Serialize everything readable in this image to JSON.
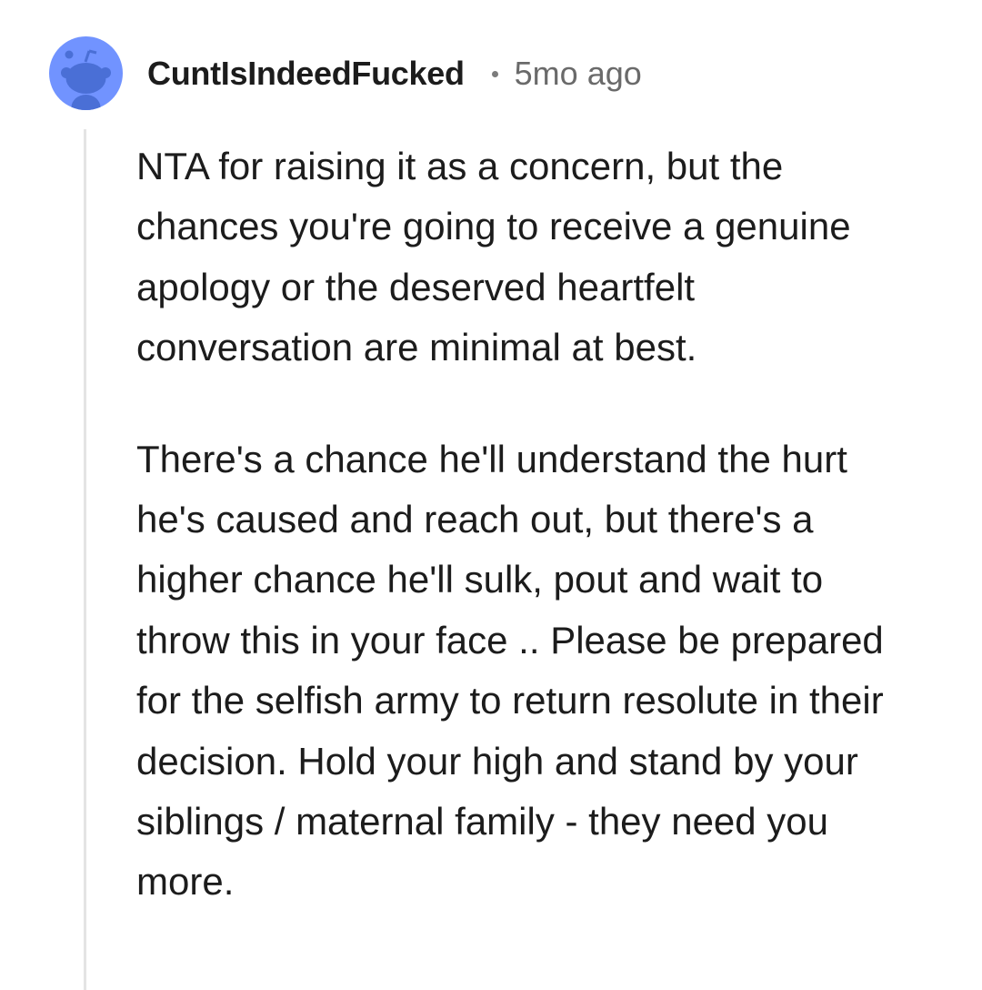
{
  "comment": {
    "author": "CuntIsIndeedFucked",
    "separator": "•",
    "timestamp": "5mo ago",
    "avatar_icon": "reddit-snoo-icon",
    "avatar_color": "#7193ff",
    "paragraphs": [
      "NTA for raising it as a concern, but the chances you're going to receive a genuine apology or the deserved heartfelt conversation are minimal at best.",
      "There's a chance he'll understand the hurt he's caused and reach out, but there's a higher chance he'll sulk, pout and wait to throw this in your face .. Please be prepared for the selfish army to return resolute in their decision. Hold your high and stand by your siblings / maternal family - they need you more."
    ]
  }
}
